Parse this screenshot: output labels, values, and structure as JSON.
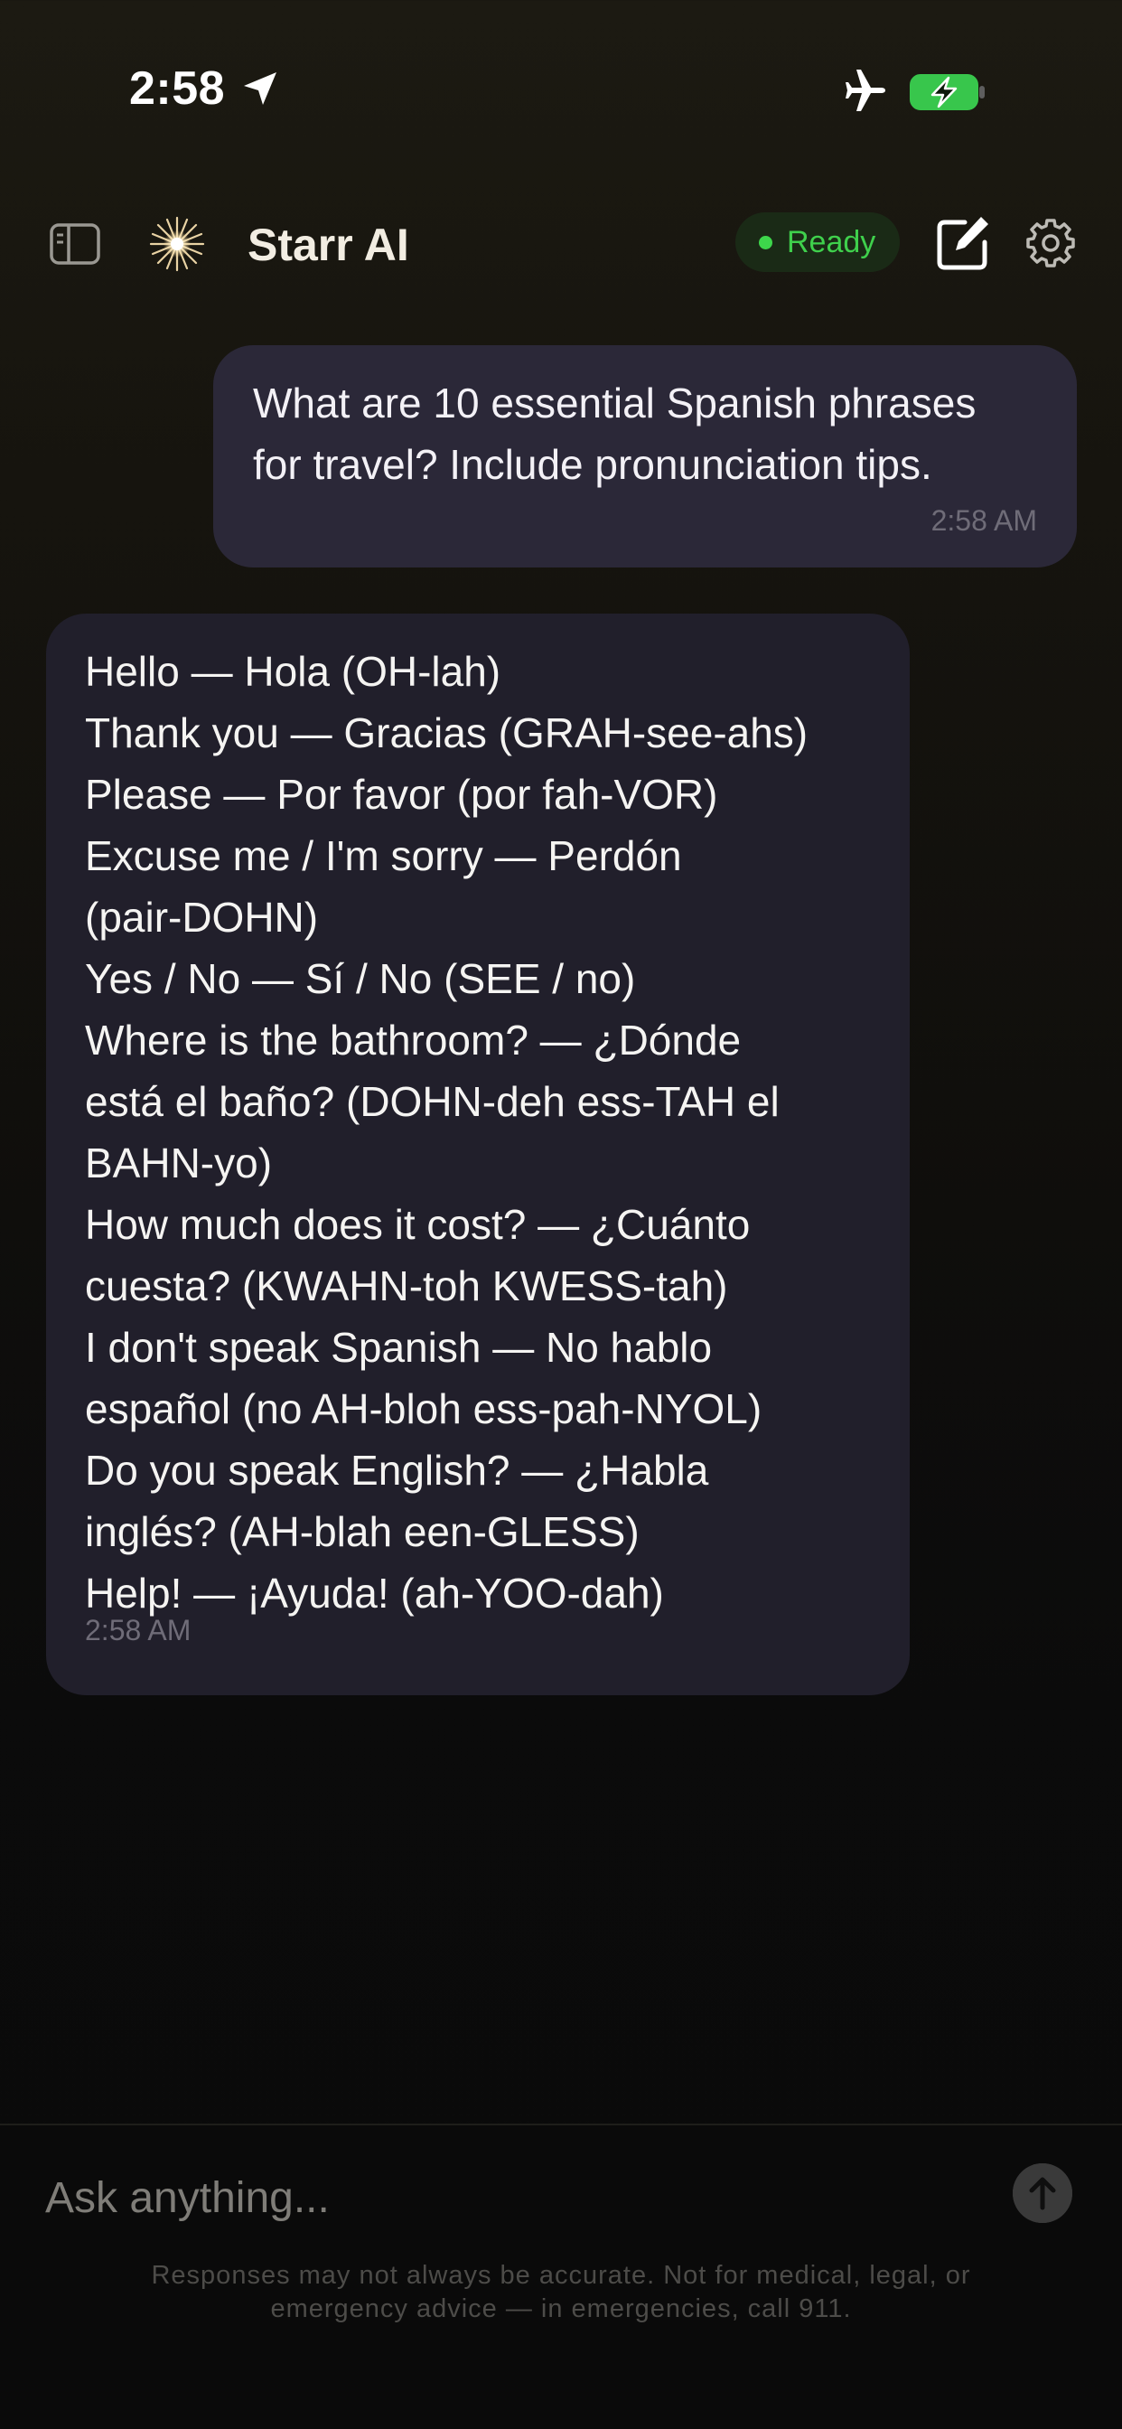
{
  "status_bar": {
    "time": "2:58"
  },
  "header": {
    "app_title": "Starr AI",
    "status_label": "Ready"
  },
  "colors": {
    "status_green": "#3dd64b",
    "user_bubble": "#2b2838",
    "assistant_bubble": "#211f2b"
  },
  "icons": {
    "status": [
      "location-icon",
      "airplane-icon",
      "battery-charging-icon"
    ],
    "header": [
      "sidebar-toggle-icon",
      "starburst-logo-icon",
      "compose-icon",
      "gear-icon"
    ],
    "composer": [
      "arrow-up-icon"
    ]
  },
  "messages": [
    {
      "role": "user",
      "text": "What are 10 essential Spanish phrases\nfor travel? Include pronunciation tips.",
      "time": "2:58 AM"
    },
    {
      "role": "assistant",
      "text": "Hello — Hola (OH-lah)\nThank you — Gracias (GRAH-see-ahs)\nPlease — Por favor (por fah-VOR)\nExcuse me / I'm sorry — Perdón\n(pair-DOHN)\nYes / No — Sí / No (SEE / no)\nWhere is the bathroom? — ¿Dónde\nestá el baño? (DOHN-deh ess-TAH el\nBAHN-yo)\nHow much does it cost? — ¿Cuánto\ncuesta? (KWAHN-toh KWESS-tah)\nI don't speak Spanish — No hablo\nespañol (no AH-bloh ess-pah-NYOL)\nDo you speak English? — ¿Habla\ninglés? (AH-blah een-GLESS)\nHelp! — ¡Ayuda! (ah-YOO-dah)",
      "time": "2:58 AM"
    }
  ],
  "composer": {
    "placeholder": "Ask anything...",
    "value": "",
    "disclaimer": "Responses may not always be accurate. Not for medical, legal, or\nemergency advice — in emergencies, call 911."
  }
}
